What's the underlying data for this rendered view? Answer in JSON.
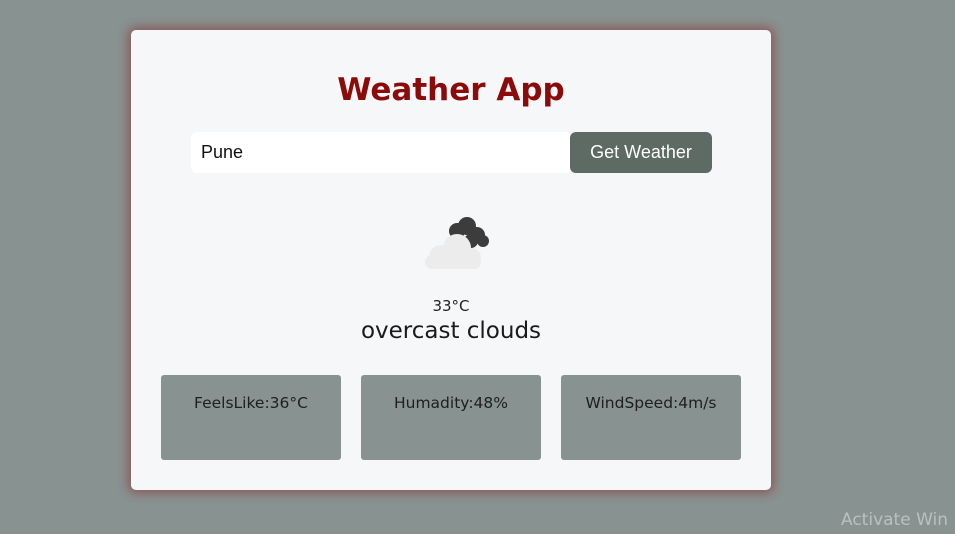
{
  "app": {
    "title": "Weather App"
  },
  "search": {
    "value": "Pune",
    "button_label": "Get Weather"
  },
  "current": {
    "icon": "overcast-clouds-icon",
    "temperature": "33°C",
    "description": "overcast clouds"
  },
  "stats": [
    {
      "label": "FeelsLike:36°C"
    },
    {
      "label": "Humadity:48%"
    },
    {
      "label": "WindSpeed:4m/s"
    }
  ],
  "watermark": "Activate Win",
  "colors": {
    "page_background": "#889291",
    "card_background": "#f6f7f9",
    "title": "#8b0a0a",
    "button": "#5d6b64",
    "stat_box": "#889291"
  }
}
